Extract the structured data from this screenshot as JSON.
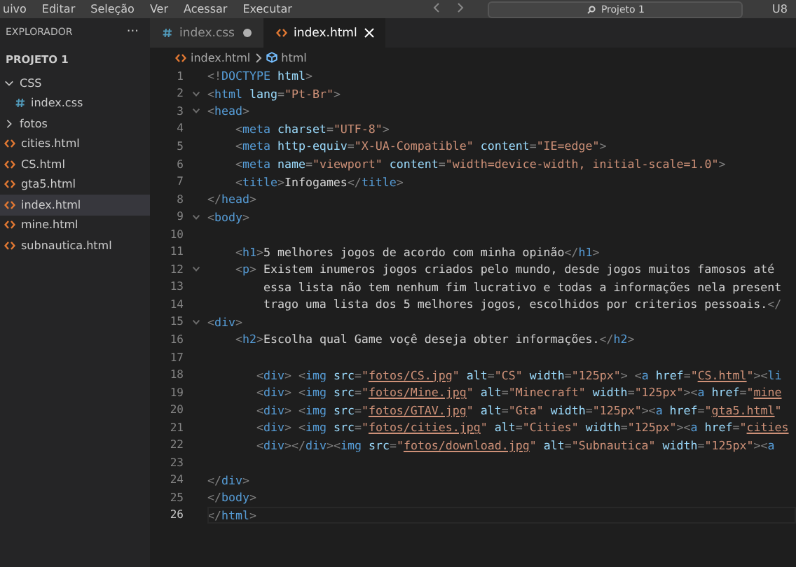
{
  "menu_bar": {
    "items": [
      "uivo",
      "Editar",
      "Seleção",
      "Ver",
      "Acessar",
      "Executar"
    ],
    "search": {
      "value": "Projeto 1"
    },
    "account": "U8"
  },
  "sidebar": {
    "title": "EXPLORADOR",
    "more": "···",
    "project": "PROJETO 1",
    "items": [
      {
        "label": "CSS",
        "kind": "folder",
        "expanded": true,
        "selected": false,
        "children": [
          {
            "label": "index.css",
            "kind": "css",
            "selected": false
          }
        ]
      },
      {
        "label": "fotos",
        "kind": "folder",
        "expanded": false,
        "selected": false
      },
      {
        "label": "cities.html",
        "kind": "html",
        "selected": false
      },
      {
        "label": "CS.html",
        "kind": "html",
        "selected": false
      },
      {
        "label": "gta5.html",
        "kind": "html",
        "selected": false
      },
      {
        "label": "index.html",
        "kind": "html",
        "selected": true
      },
      {
        "label": "mine.html",
        "kind": "html",
        "selected": false
      },
      {
        "label": "subnautica.html",
        "kind": "html",
        "selected": false
      }
    ]
  },
  "tabs": [
    {
      "label": "index.css",
      "kind": "css",
      "selected": false,
      "modified": true
    },
    {
      "label": "index.html",
      "kind": "html",
      "selected": true,
      "modified": false
    }
  ],
  "breadcrumb": [
    "index.html",
    "html"
  ],
  "editor": {
    "lines": [
      {
        "number": "1",
        "fold": false,
        "current": false,
        "tokens": [
          {
            "kind": "p",
            "text": "<!"
          },
          {
            "kind": "tag",
            "text": "DOCTYPE"
          },
          {
            "kind": "attr",
            "text": " html"
          },
          {
            "kind": "p",
            "text": ">"
          }
        ]
      },
      {
        "number": "2",
        "fold": true,
        "current": false,
        "tokens": [
          {
            "kind": "p",
            "text": "<"
          },
          {
            "kind": "tag",
            "text": "html"
          },
          {
            "kind": "attr",
            "text": " lang"
          },
          {
            "kind": "p",
            "text": "="
          },
          {
            "kind": "str",
            "text": "\"Pt-Br\""
          },
          {
            "kind": "p",
            "text": ">"
          }
        ]
      },
      {
        "number": "3",
        "fold": true,
        "current": false,
        "tokens": [
          {
            "kind": "p",
            "text": "<"
          },
          {
            "kind": "tag",
            "text": "head"
          },
          {
            "kind": "p",
            "text": ">"
          }
        ]
      },
      {
        "number": "4",
        "fold": false,
        "current": false,
        "tokens": [
          {
            "kind": "p",
            "text": "    <"
          },
          {
            "kind": "tag",
            "text": "meta"
          },
          {
            "kind": "attr",
            "text": " charset"
          },
          {
            "kind": "p",
            "text": "="
          },
          {
            "kind": "str",
            "text": "\"UTF-8\""
          },
          {
            "kind": "p",
            "text": ">"
          }
        ]
      },
      {
        "number": "5",
        "fold": false,
        "current": false,
        "tokens": [
          {
            "kind": "p",
            "text": "    <"
          },
          {
            "kind": "tag",
            "text": "meta"
          },
          {
            "kind": "attr",
            "text": " http-equiv"
          },
          {
            "kind": "p",
            "text": "="
          },
          {
            "kind": "str",
            "text": "\"X-UA-Compatible\""
          },
          {
            "kind": "attr",
            "text": " content"
          },
          {
            "kind": "p",
            "text": "="
          },
          {
            "kind": "str",
            "text": "\"IE=edge\""
          },
          {
            "kind": "p",
            "text": ">"
          }
        ]
      },
      {
        "number": "6",
        "fold": false,
        "current": false,
        "tokens": [
          {
            "kind": "p",
            "text": "    <"
          },
          {
            "kind": "tag",
            "text": "meta"
          },
          {
            "kind": "attr",
            "text": " name"
          },
          {
            "kind": "p",
            "text": "="
          },
          {
            "kind": "str",
            "text": "\"viewport\""
          },
          {
            "kind": "attr",
            "text": " content"
          },
          {
            "kind": "p",
            "text": "="
          },
          {
            "kind": "str",
            "text": "\"width=device-width, initial-scale=1.0\""
          },
          {
            "kind": "p",
            "text": ">"
          }
        ]
      },
      {
        "number": "7",
        "fold": false,
        "current": false,
        "tokens": [
          {
            "kind": "p",
            "text": "    <"
          },
          {
            "kind": "tag",
            "text": "title"
          },
          {
            "kind": "p",
            "text": ">"
          },
          {
            "kind": "text",
            "text": "Infogames"
          },
          {
            "kind": "p",
            "text": "</"
          },
          {
            "kind": "tag",
            "text": "title"
          },
          {
            "kind": "p",
            "text": ">"
          }
        ]
      },
      {
        "number": "8",
        "fold": false,
        "current": false,
        "tokens": [
          {
            "kind": "p",
            "text": "</"
          },
          {
            "kind": "tag",
            "text": "head"
          },
          {
            "kind": "p",
            "text": ">"
          }
        ]
      },
      {
        "number": "9",
        "fold": true,
        "current": false,
        "tokens": [
          {
            "kind": "p",
            "text": "<"
          },
          {
            "kind": "tag",
            "text": "body"
          },
          {
            "kind": "p",
            "text": ">"
          }
        ]
      },
      {
        "number": "10",
        "fold": false,
        "current": false
      },
      {
        "number": "11",
        "fold": false,
        "current": false,
        "tokens": [
          {
            "kind": "p",
            "text": "    <"
          },
          {
            "kind": "tag",
            "text": "h1"
          },
          {
            "kind": "p",
            "text": ">"
          },
          {
            "kind": "text",
            "text": "5 melhores jogos de acordo com minha opinão"
          },
          {
            "kind": "p",
            "text": "</"
          },
          {
            "kind": "tag",
            "text": "h1"
          },
          {
            "kind": "p",
            "text": ">"
          }
        ]
      },
      {
        "number": "12",
        "fold": true,
        "current": false,
        "tokens": [
          {
            "kind": "p",
            "text": "    <"
          },
          {
            "kind": "tag",
            "text": "p"
          },
          {
            "kind": "p",
            "text": ">"
          },
          {
            "kind": "text",
            "text": " Existem inumeros jogos criados pelo mundo, desde jogos muitos famosos até"
          }
        ]
      },
      {
        "number": "13",
        "fold": false,
        "current": false,
        "tokens": [
          {
            "kind": "text",
            "text": "        essa lista não tem nenhum fim lucrativo e todas a informações nela present"
          }
        ]
      },
      {
        "number": "14",
        "fold": false,
        "current": false,
        "tokens": [
          {
            "kind": "text",
            "text": "        trago uma lista dos 5 melhores jogos, escolhidos por criterios pessoais."
          },
          {
            "kind": "p",
            "text": "</"
          }
        ]
      },
      {
        "number": "15",
        "fold": true,
        "current": false,
        "tokens": [
          {
            "kind": "p",
            "text": "<"
          },
          {
            "kind": "tag",
            "text": "div"
          },
          {
            "kind": "p",
            "text": ">"
          }
        ]
      },
      {
        "number": "16",
        "fold": false,
        "current": false,
        "tokens": [
          {
            "kind": "p",
            "text": "    <"
          },
          {
            "kind": "tag",
            "text": "h2"
          },
          {
            "kind": "p",
            "text": ">"
          },
          {
            "kind": "text",
            "text": "Escolha qual Game voçê deseja obter informações."
          },
          {
            "kind": "p",
            "text": "</"
          },
          {
            "kind": "tag",
            "text": "h2"
          },
          {
            "kind": "p",
            "text": ">"
          }
        ]
      },
      {
        "number": "17",
        "fold": false,
        "current": false
      },
      {
        "number": "18",
        "fold": false,
        "current": false,
        "tokens": [
          {
            "kind": "p",
            "text": "       <"
          },
          {
            "kind": "tag",
            "text": "div"
          },
          {
            "kind": "p",
            "text": "> <"
          },
          {
            "kind": "tag",
            "text": "img"
          },
          {
            "kind": "attr",
            "text": " src"
          },
          {
            "kind": "p",
            "text": "="
          },
          {
            "kind": "str",
            "text": "\""
          },
          {
            "kind": "link",
            "text": "fotos/CS.jpg"
          },
          {
            "kind": "str",
            "text": "\""
          },
          {
            "kind": "attr",
            "text": " alt"
          },
          {
            "kind": "p",
            "text": "="
          },
          {
            "kind": "str",
            "text": "\"CS\""
          },
          {
            "kind": "attr",
            "text": " width"
          },
          {
            "kind": "p",
            "text": "="
          },
          {
            "kind": "str",
            "text": "\"125px\""
          },
          {
            "kind": "p",
            "text": "> <"
          },
          {
            "kind": "tag",
            "text": "a"
          },
          {
            "kind": "attr",
            "text": " href"
          },
          {
            "kind": "p",
            "text": "="
          },
          {
            "kind": "str",
            "text": "\""
          },
          {
            "kind": "link",
            "text": "CS.html"
          },
          {
            "kind": "str",
            "text": "\""
          },
          {
            "kind": "p",
            "text": "><"
          },
          {
            "kind": "tag",
            "text": "li"
          }
        ]
      },
      {
        "number": "19",
        "fold": false,
        "current": false,
        "tokens": [
          {
            "kind": "p",
            "text": "       <"
          },
          {
            "kind": "tag",
            "text": "div"
          },
          {
            "kind": "p",
            "text": "> <"
          },
          {
            "kind": "tag",
            "text": "img"
          },
          {
            "kind": "attr",
            "text": " src"
          },
          {
            "kind": "p",
            "text": "="
          },
          {
            "kind": "str",
            "text": "\""
          },
          {
            "kind": "link",
            "text": "fotos/Mine.jpg"
          },
          {
            "kind": "str",
            "text": "\""
          },
          {
            "kind": "attr",
            "text": " alt"
          },
          {
            "kind": "p",
            "text": "="
          },
          {
            "kind": "str",
            "text": "\"Minecraft\""
          },
          {
            "kind": "attr",
            "text": " width"
          },
          {
            "kind": "p",
            "text": "="
          },
          {
            "kind": "str",
            "text": "\"125px\""
          },
          {
            "kind": "p",
            "text": "><"
          },
          {
            "kind": "tag",
            "text": "a"
          },
          {
            "kind": "attr",
            "text": " href"
          },
          {
            "kind": "p",
            "text": "="
          },
          {
            "kind": "str",
            "text": "\""
          },
          {
            "kind": "link",
            "text": "mine"
          }
        ]
      },
      {
        "number": "20",
        "fold": false,
        "current": false,
        "tokens": [
          {
            "kind": "p",
            "text": "       <"
          },
          {
            "kind": "tag",
            "text": "div"
          },
          {
            "kind": "p",
            "text": "> <"
          },
          {
            "kind": "tag",
            "text": "img"
          },
          {
            "kind": "attr",
            "text": " src"
          },
          {
            "kind": "p",
            "text": "="
          },
          {
            "kind": "str",
            "text": "\""
          },
          {
            "kind": "link",
            "text": "fotos/GTAV.jpg"
          },
          {
            "kind": "str",
            "text": "\""
          },
          {
            "kind": "attr",
            "text": " alt"
          },
          {
            "kind": "p",
            "text": "="
          },
          {
            "kind": "str",
            "text": "\"Gta\""
          },
          {
            "kind": "attr",
            "text": " width"
          },
          {
            "kind": "p",
            "text": "="
          },
          {
            "kind": "str",
            "text": "\"125px\""
          },
          {
            "kind": "p",
            "text": "><"
          },
          {
            "kind": "tag",
            "text": "a"
          },
          {
            "kind": "attr",
            "text": " href"
          },
          {
            "kind": "p",
            "text": "="
          },
          {
            "kind": "str",
            "text": "\""
          },
          {
            "kind": "link",
            "text": "gta5.html"
          },
          {
            "kind": "str",
            "text": "\""
          }
        ]
      },
      {
        "number": "21",
        "fold": false,
        "current": false,
        "tokens": [
          {
            "kind": "p",
            "text": "       <"
          },
          {
            "kind": "tag",
            "text": "div"
          },
          {
            "kind": "p",
            "text": "> <"
          },
          {
            "kind": "tag",
            "text": "img"
          },
          {
            "kind": "attr",
            "text": " src"
          },
          {
            "kind": "p",
            "text": "="
          },
          {
            "kind": "str",
            "text": "\""
          },
          {
            "kind": "link",
            "text": "fotos/cities.jpg"
          },
          {
            "kind": "str",
            "text": "\""
          },
          {
            "kind": "attr",
            "text": " alt"
          },
          {
            "kind": "p",
            "text": "="
          },
          {
            "kind": "str",
            "text": "\"Cities\""
          },
          {
            "kind": "attr",
            "text": " width"
          },
          {
            "kind": "p",
            "text": "="
          },
          {
            "kind": "str",
            "text": "\"125px\""
          },
          {
            "kind": "p",
            "text": "><"
          },
          {
            "kind": "tag",
            "text": "a"
          },
          {
            "kind": "attr",
            "text": " href"
          },
          {
            "kind": "p",
            "text": "="
          },
          {
            "kind": "str",
            "text": "\""
          },
          {
            "kind": "link",
            "text": "cities"
          }
        ]
      },
      {
        "number": "22",
        "fold": false,
        "current": false,
        "tokens": [
          {
            "kind": "p",
            "text": "       <"
          },
          {
            "kind": "tag",
            "text": "div"
          },
          {
            "kind": "p",
            "text": "></"
          },
          {
            "kind": "tag",
            "text": "div"
          },
          {
            "kind": "p",
            "text": "><"
          },
          {
            "kind": "tag",
            "text": "img"
          },
          {
            "kind": "attr",
            "text": " src"
          },
          {
            "kind": "p",
            "text": "="
          },
          {
            "kind": "str",
            "text": "\""
          },
          {
            "kind": "link",
            "text": "fotos/download.jpg"
          },
          {
            "kind": "str",
            "text": "\""
          },
          {
            "kind": "attr",
            "text": " alt"
          },
          {
            "kind": "p",
            "text": "="
          },
          {
            "kind": "str",
            "text": "\"Subnautica\""
          },
          {
            "kind": "attr",
            "text": " width"
          },
          {
            "kind": "p",
            "text": "="
          },
          {
            "kind": "str",
            "text": "\"125px\""
          },
          {
            "kind": "p",
            "text": "><"
          },
          {
            "kind": "tag",
            "text": "a"
          }
        ]
      },
      {
        "number": "23",
        "fold": false,
        "current": false
      },
      {
        "number": "24",
        "fold": false,
        "current": false,
        "tokens": [
          {
            "kind": "p",
            "text": "</"
          },
          {
            "kind": "tag",
            "text": "div"
          },
          {
            "kind": "p",
            "text": ">"
          }
        ]
      },
      {
        "number": "25",
        "fold": false,
        "current": false,
        "tokens": [
          {
            "kind": "p",
            "text": "</"
          },
          {
            "kind": "tag",
            "text": "body"
          },
          {
            "kind": "p",
            "text": ">"
          }
        ]
      },
      {
        "number": "26",
        "fold": false,
        "current": true,
        "tokens": [
          {
            "kind": "p",
            "text": "</"
          },
          {
            "kind": "tag",
            "text": "html"
          },
          {
            "kind": "p",
            "text": ">"
          }
        ]
      }
    ]
  }
}
